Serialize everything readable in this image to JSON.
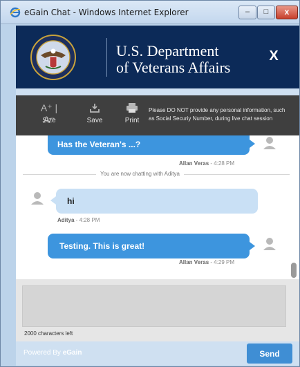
{
  "window": {
    "title": "eGain Chat - Windows Internet Explorer",
    "controls": {
      "minimize": "–",
      "maximize": "□",
      "close": "x"
    }
  },
  "header": {
    "org_line1": "U.S. Department",
    "org_line2": "of Veterans Affairs",
    "close_label": "X",
    "logo": "va-seal-icon"
  },
  "toolbar": {
    "size": {
      "icon": "A⁺ | A⁻",
      "label": "Size"
    },
    "save": {
      "icon": "save-icon",
      "label": "Save"
    },
    "print": {
      "icon": "print-icon",
      "label": "Print"
    },
    "notice": "Please DO NOT provide any personal information, such as Social Securiy Number, during live chat session"
  },
  "messages": [
    {
      "role": "agent",
      "text": "Has the Veteran's ...?",
      "author": "Allan Veras",
      "time": "4:28 PM"
    },
    {
      "role": "system",
      "text": "You are now chatting with Aditya"
    },
    {
      "role": "visitor",
      "text": "hi",
      "author": "Aditya",
      "time": "4:28 PM"
    },
    {
      "role": "agent",
      "text": "Testing. This is great!",
      "author": "Allan Veras",
      "time": "4:29 PM"
    }
  ],
  "compose": {
    "value": "",
    "chars_left": "2000 characters left"
  },
  "footer": {
    "powered_prefix": "Powered By",
    "powered_brand": "eGain",
    "send_label": "Send"
  },
  "colors": {
    "header_bg": "#0c2a58",
    "toolbar_bg": "#3f3f3f",
    "agent_bubble": "#3d95de",
    "visitor_bubble": "#c9e0f5",
    "send_button": "#3f8ed4"
  }
}
